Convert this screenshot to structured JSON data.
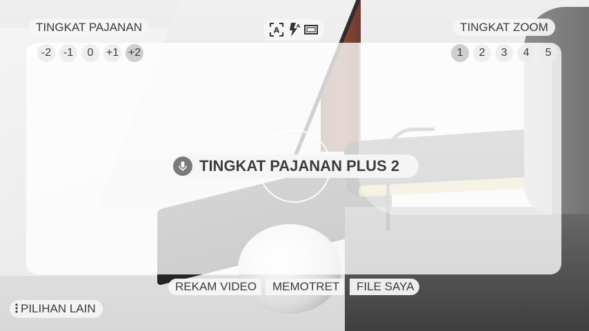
{
  "exposure": {
    "title": "TINGKAT PAJANAN",
    "levels": [
      "-2",
      "-1",
      "0",
      "+1",
      "+2"
    ]
  },
  "zoom": {
    "title": "TINGKAT ZOOM",
    "levels": [
      "1",
      "2",
      "3",
      "4",
      "5"
    ]
  },
  "mode_icons": [
    "auto-focus-icon",
    "flash-auto-icon",
    "aspect-ratio-icon"
  ],
  "toast": {
    "icon": "microphone-icon",
    "text": "TINGKAT PAJANAN PLUS 2"
  },
  "actions": {
    "record_video": "REKAM VIDEO",
    "take_photo": "MEMOTRET",
    "my_files": "FILE SAYA"
  },
  "more_options": {
    "icon": "more-vertical-icon",
    "label": "PILIHAN LAIN"
  }
}
